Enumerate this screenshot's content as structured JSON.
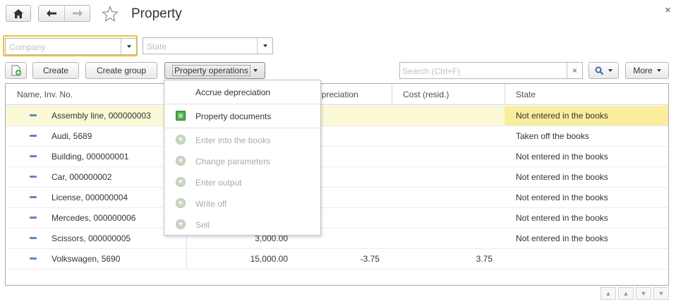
{
  "window": {
    "title": "Property",
    "close_glyph": "×"
  },
  "filters": {
    "company_placeholder": "Company",
    "state_placeholder": "State"
  },
  "toolbar": {
    "create_label": "Create",
    "create_group_label": "Create group",
    "property_operations_label": "Property operations",
    "search_placeholder": "Search (Ctrl+F)",
    "clear_glyph": "×",
    "more_label": "More"
  },
  "table": {
    "columns": [
      "Name, Inv. No.",
      "Depreciation",
      "Cost (resid.)",
      "State"
    ],
    "visible_depreciation_header": "epreciation",
    "rows": [
      {
        "name": "Assembly line, 000000003",
        "cost": "",
        "depreciation": "",
        "residual": "",
        "state": "Not entered in the books",
        "selected": true
      },
      {
        "name": "Audi, 5689",
        "cost": "",
        "depreciation": "",
        "residual": "",
        "state": "Taken off the books"
      },
      {
        "name": "Building, 000000001",
        "cost": "",
        "depreciation": "",
        "residual": "",
        "state": "Not entered in the books"
      },
      {
        "name": "Car, 000000002",
        "cost": "",
        "depreciation": "",
        "residual": "",
        "state": "Not entered in the books"
      },
      {
        "name": "License, 000000004",
        "cost": "",
        "depreciation": "",
        "residual": "",
        "state": "Not entered in the books"
      },
      {
        "name": "Mercedes, 000000006",
        "cost": "",
        "depreciation": "",
        "residual": "",
        "state": "Not entered in the books"
      },
      {
        "name": "Scissors, 000000005",
        "cost": "3,000.00",
        "depreciation": "",
        "residual": "",
        "state": "Not entered in the books"
      },
      {
        "name": "Volkswagen, 5690",
        "cost": "15,000.00",
        "depreciation": "-3.75",
        "residual": "3.75",
        "state": ""
      }
    ]
  },
  "menu": {
    "items": [
      {
        "label": "Accrue depreciation",
        "icon": "none",
        "enabled": true
      },
      {
        "label": "Property documents",
        "icon": "document-icon",
        "enabled": true
      },
      {
        "label": "Enter into the books",
        "icon": "plus-circle-icon",
        "enabled": false
      },
      {
        "label": "Change parameters",
        "icon": "plus-circle-icon",
        "enabled": false
      },
      {
        "label": "Enter output",
        "icon": "plus-circle-icon",
        "enabled": false
      },
      {
        "label": "Write off",
        "icon": "plus-circle-icon",
        "enabled": false
      },
      {
        "label": "Sell",
        "icon": "plus-circle-icon",
        "enabled": false
      }
    ]
  },
  "colors": {
    "selected_row": "#fbf8d5",
    "selected_state_cell": "#fbed9e",
    "company_focus_border": "#f2c230",
    "row_marker": "#5f85c0"
  }
}
